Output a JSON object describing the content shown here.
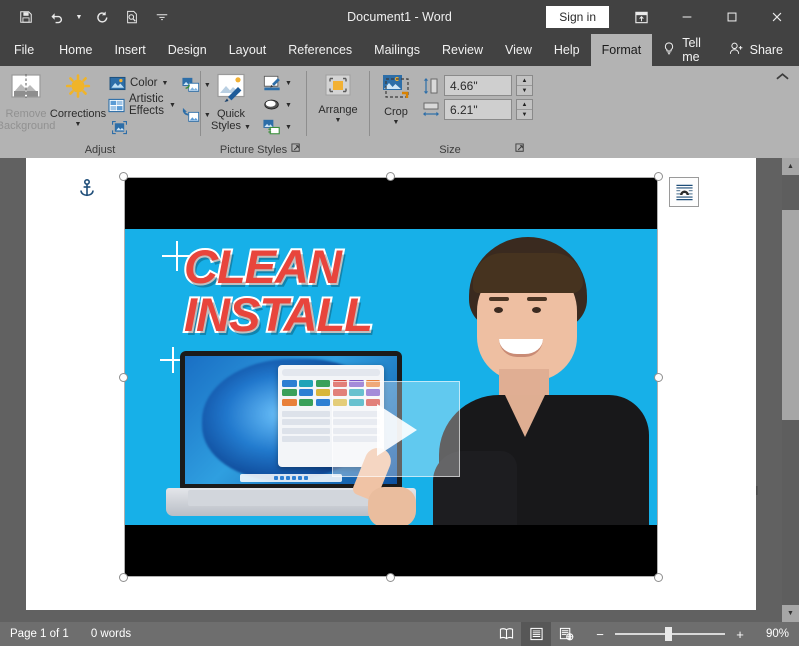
{
  "window": {
    "title": "Document1  -  Word",
    "signin_label": "Sign in",
    "quick_access": [
      {
        "name": "save-icon",
        "label": "Save"
      },
      {
        "name": "undo-icon",
        "label": "Undo"
      },
      {
        "name": "redo-icon",
        "label": "Redo"
      },
      {
        "name": "print-preview-icon",
        "label": "Print Preview and Print"
      },
      {
        "name": "customize-quick-access-toolbar-icon",
        "label": "Customize Quick Access Toolbar"
      }
    ],
    "controls": [
      {
        "name": "ribbon-display-options-icon",
        "label": "Ribbon Display Options"
      },
      {
        "name": "minimize-icon",
        "label": "Minimize"
      },
      {
        "name": "maximize-icon",
        "label": "Restore Down"
      },
      {
        "name": "close-icon",
        "label": "Close"
      }
    ]
  },
  "tabs": [
    {
      "label": "File",
      "active": false
    },
    {
      "label": "Home",
      "active": false
    },
    {
      "label": "Insert",
      "active": false
    },
    {
      "label": "Design",
      "active": false
    },
    {
      "label": "Layout",
      "active": false
    },
    {
      "label": "References",
      "active": false
    },
    {
      "label": "Mailings",
      "active": false
    },
    {
      "label": "Review",
      "active": false
    },
    {
      "label": "View",
      "active": false
    },
    {
      "label": "Help",
      "active": false
    },
    {
      "label": "Format",
      "active": true
    }
  ],
  "tellme": {
    "label": "Tell me",
    "icon": "lightbulb-icon"
  },
  "share": {
    "label": "Share",
    "icon": "share-person-icon"
  },
  "ribbon": {
    "collapse_label": "Collapse the Ribbon",
    "groups": [
      {
        "name": "adjust",
        "label": "Adjust",
        "dialog_launcher": false,
        "items": [
          {
            "name": "remove-background-button",
            "label": "Remove\nBackground",
            "line1": "Remove",
            "line2": "Background",
            "disabled": true
          },
          {
            "name": "corrections-button",
            "label": "Corrections",
            "disabled": false
          },
          {
            "name": "color-button",
            "label": "Color",
            "disabled": false
          },
          {
            "name": "artistic-effects-button",
            "label": "Artistic Effects",
            "disabled": false
          },
          {
            "name": "compress-pictures-button",
            "label": "Compress Pictures",
            "disabled": false
          },
          {
            "name": "change-picture-button",
            "label": "Change Picture",
            "disabled": false
          },
          {
            "name": "reset-picture-button",
            "label": "Reset Picture",
            "disabled": false
          }
        ]
      },
      {
        "name": "picture-styles",
        "label": "Picture Styles",
        "dialog_launcher": true,
        "items": [
          {
            "name": "quick-styles-button",
            "line1": "Quick",
            "line2": "Styles"
          },
          {
            "name": "picture-border-button",
            "label": "Picture Border"
          },
          {
            "name": "picture-effects-button",
            "label": "Picture Effects"
          },
          {
            "name": "picture-layout-button",
            "label": "Picture Layout"
          }
        ]
      },
      {
        "name": "arrange",
        "label": "",
        "dialog_launcher": false,
        "items": [
          {
            "name": "arrange-button",
            "label": "Arrange"
          }
        ]
      },
      {
        "name": "size",
        "label": "Size",
        "dialog_launcher": true,
        "items": [
          {
            "name": "crop-button",
            "label": "Crop"
          }
        ],
        "height_field": {
          "name": "shape-height-input",
          "value": "4.66\"",
          "label": "Shape Height"
        },
        "width_field": {
          "name": "shape-width-input",
          "value": "6.21\"",
          "label": "Shape Width"
        }
      }
    ]
  },
  "document": {
    "anchor_label": "Object anchor",
    "layout_options_label": "Layout Options",
    "picture": {
      "name": "selected-picture",
      "alt": "YouTube thumbnail: CLEAN INSTALL with laptop showing Windows 11 and a person pointing",
      "title_line1": "CLEAN",
      "title_line2": "INSTALL",
      "background_color": "#17b0e8",
      "title_color": "#e8453c",
      "letterbox_color": "#000000",
      "selected": true,
      "handle_count": 8
    }
  },
  "statusbar": {
    "page_label": "Page 1 of 1",
    "word_count": "0 words",
    "views": [
      {
        "name": "read-mode-view-button",
        "label": "Read Mode",
        "active": false
      },
      {
        "name": "print-layout-view-button",
        "label": "Print Layout",
        "active": true
      },
      {
        "name": "web-layout-view-button",
        "label": "Web Layout",
        "active": false
      }
    ],
    "zoom": {
      "minus": "−",
      "plus": "+",
      "value": "90%",
      "percent": 90
    }
  }
}
